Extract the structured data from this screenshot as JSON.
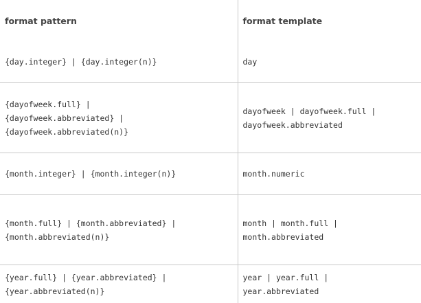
{
  "table": {
    "headers": [
      "format pattern",
      "format template"
    ],
    "rows": [
      {
        "pattern": [
          "{day.integer} | {day.integer(n)}"
        ],
        "template": [
          "day"
        ]
      },
      {
        "pattern": [
          "{dayofweek.full} |",
          "{dayofweek.abbreviated} |",
          "{dayofweek.abbreviated(n)}"
        ],
        "template": [
          "dayofweek | dayofweek.full |",
          "dayofweek.abbreviated"
        ]
      },
      {
        "pattern": [
          "{month.integer} | {month.integer(n)}"
        ],
        "template": [
          "month.numeric"
        ]
      },
      {
        "pattern": [
          "{month.full} | {month.abbreviated} |",
          "{month.abbreviated(n)}"
        ],
        "template": [
          "month | month.full |",
          "month.abbreviated"
        ]
      },
      {
        "pattern": [
          "{year.full} | {year.abbreviated} |",
          "{year.abbreviated(n)}"
        ],
        "template": [
          "year | year.full |",
          "year.abbreviated"
        ]
      }
    ]
  }
}
